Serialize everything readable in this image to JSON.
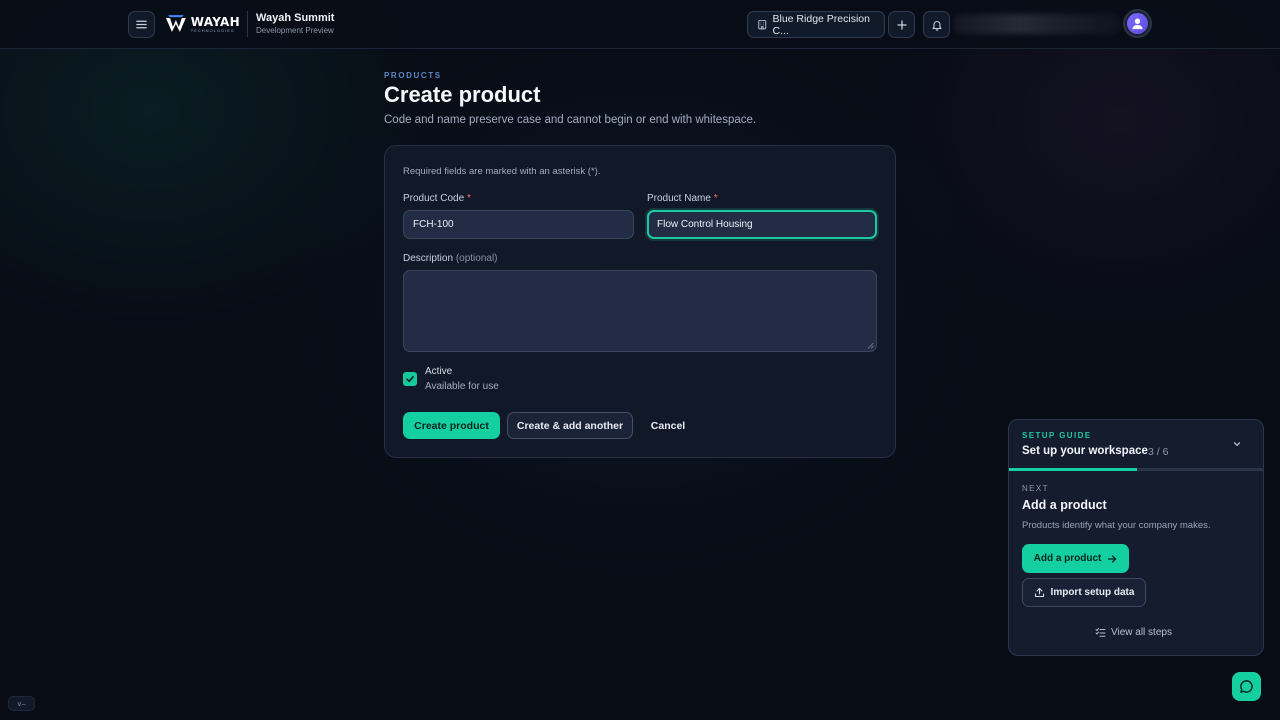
{
  "header": {
    "logo_word": "WAYAH",
    "logo_sub": "TECHNOLOGIES",
    "app_title": "Wayah Summit",
    "app_subtitle": "Development Preview",
    "org_name": "Blue Ridge Precision C...",
    "icons": [
      "menu-icon",
      "building-icon",
      "plus-icon",
      "bell-icon",
      "user-icon"
    ]
  },
  "page": {
    "eyebrow": "PRODUCTS",
    "title": "Create product",
    "subtitle": "Code and name preserve case and cannot begin or end with whitespace."
  },
  "form": {
    "required_note": "Required fields are marked with an asterisk (*).",
    "code_label": "Product Code",
    "code_value": "FCH-100",
    "name_label": "Product Name",
    "name_value": "Flow Control Housing",
    "required_marker": "*",
    "description_label": "Description",
    "description_optional": "(optional)",
    "description_value": "",
    "active_label": "Active",
    "active_sub": "Available for use",
    "active_checked": true,
    "submit_label": "Create product",
    "submit_another_label": "Create & add another",
    "cancel_label": "Cancel"
  },
  "setup_guide": {
    "eyebrow": "SETUP GUIDE",
    "title": "Set up your workspace",
    "count": "3 / 6",
    "progress_fraction": 0.5,
    "next_label": "NEXT",
    "next_title": "Add a product",
    "next_desc": "Products identify what your company makes.",
    "primary_label": "Add a product",
    "secondary_label": "Import setup data",
    "link_label": "View all steps"
  },
  "footer": {
    "version_label": "v—"
  },
  "colors": {
    "accent": "#14d0a1",
    "background": "#070c15",
    "card": "#121a2a",
    "required": "#ff6b6b"
  }
}
